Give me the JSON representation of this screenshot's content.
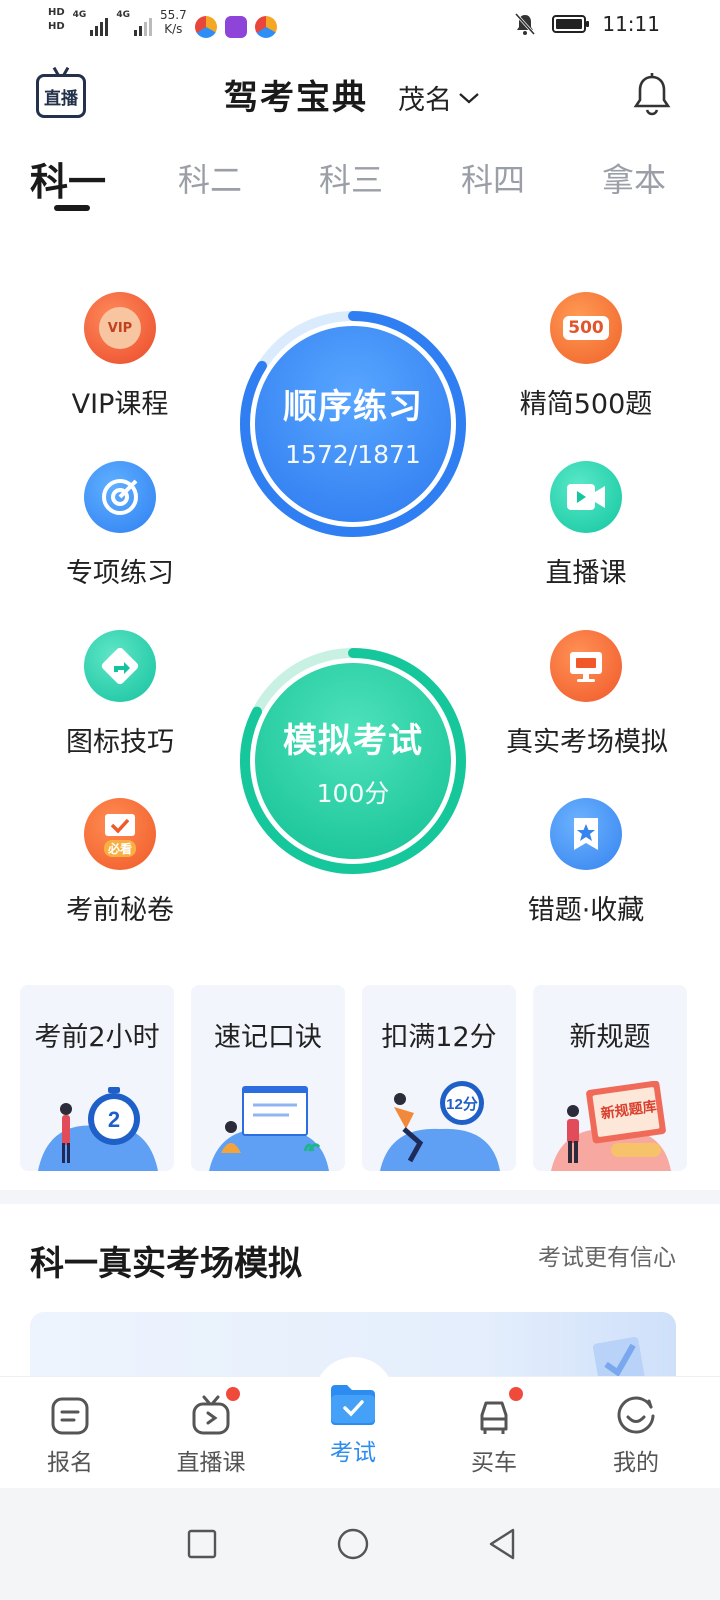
{
  "status_bar": {
    "hd1": "HD",
    "hd2": "HD",
    "net1": "4G",
    "net2": "4G",
    "speed_value": "55.7",
    "speed_unit": "K/s",
    "time": "11:11",
    "icons": [
      "bell-off-icon",
      "battery-icon"
    ]
  },
  "header": {
    "live_label": "直播",
    "title": "驾考宝典",
    "city": "茂名",
    "icons": [
      "live-tv-icon",
      "chevron-down-icon",
      "bell-icon"
    ]
  },
  "tabs": [
    {
      "label": "科一",
      "active": true
    },
    {
      "label": "科二",
      "active": false
    },
    {
      "label": "科三",
      "active": false
    },
    {
      "label": "科四",
      "active": false
    },
    {
      "label": "拿本",
      "active": false
    }
  ],
  "features": {
    "vip": {
      "label": "VIP课程",
      "badge": "VIP",
      "color": "#f05a3a"
    },
    "special": {
      "label": "专项练习",
      "color": "#2f8ef5"
    },
    "signs": {
      "label": "图标技巧",
      "color": "#19c8a6"
    },
    "secret": {
      "label": "考前秘卷",
      "badge": "必看",
      "color": "#f5632f"
    },
    "simple500": {
      "label": "精简500题",
      "badge": "500",
      "color": "#f5722f"
    },
    "live_course": {
      "label": "直播课",
      "color": "#1ccfae"
    },
    "real_exam": {
      "label": "真实考场模拟",
      "color": "#f5652f"
    },
    "mistakes": {
      "label": "错题·收藏",
      "color": "#3d8ff2"
    }
  },
  "order_practice": {
    "title": "顺序练习",
    "done": 1572,
    "total": 1871,
    "progress_text": "1572/1871",
    "color": "#2f7ff2"
  },
  "mock_exam": {
    "title": "模拟考试",
    "score_text": "100分",
    "color": "#16c79c"
  },
  "quick_cards": [
    {
      "label": "考前2小时",
      "art_text": "2"
    },
    {
      "label": "速记口诀",
      "art_text": ""
    },
    {
      "label": "扣满12分",
      "art_text": "12分"
    },
    {
      "label": "新规题",
      "art_text": "新规题库"
    }
  ],
  "section": {
    "title": "科一真实考场模拟",
    "subtitle": "考试更有信心"
  },
  "bottom_nav": [
    {
      "label": "报名",
      "icon": "signup-icon",
      "dot": false,
      "active": false
    },
    {
      "label": "直播课",
      "icon": "tv-icon",
      "dot": true,
      "active": false
    },
    {
      "label": "考试",
      "icon": "exam-folder-icon",
      "dot": false,
      "active": true
    },
    {
      "label": "买车",
      "icon": "car-icon",
      "dot": true,
      "active": false
    },
    {
      "label": "我的",
      "icon": "smile-icon",
      "dot": false,
      "active": false
    }
  ],
  "system_nav": [
    "recent-apps-icon",
    "home-icon",
    "back-icon"
  ],
  "colors": {
    "accent": "#2d8cf0",
    "red_dot": "#f04a3a"
  }
}
